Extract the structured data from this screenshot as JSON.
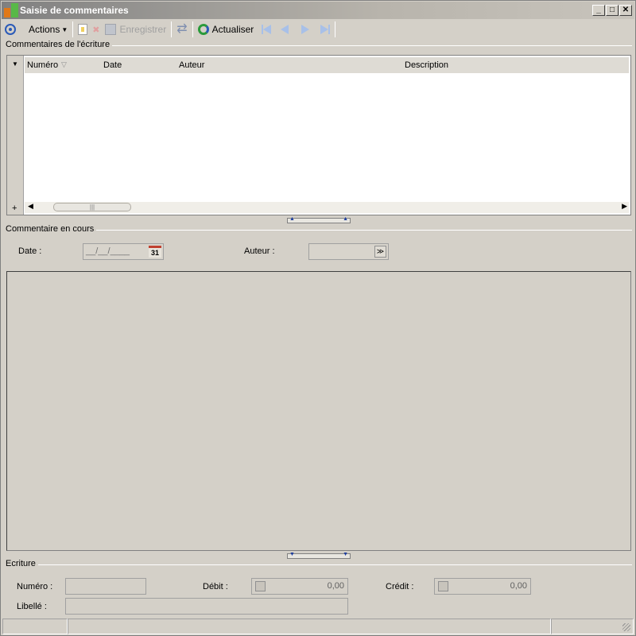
{
  "window": {
    "title": "Saisie de commentaires"
  },
  "toolbar": {
    "actions_label": "Actions",
    "save_label": "Enregistrer",
    "refresh_label": "Actualiser"
  },
  "grid_group": {
    "title": "Commentaires de l'écriture",
    "columns": [
      "Numéro",
      "Date",
      "Auteur",
      "Description"
    ],
    "add_label": "+"
  },
  "current": {
    "title": "Commentaire en cours",
    "date_label": "Date :",
    "date_value": "__/__/____",
    "calendar_day": "31",
    "author_label": "Auteur :"
  },
  "entry": {
    "title": "Ecriture",
    "number_label": "Numéro :",
    "debit_label": "Débit :",
    "debit_value": "0,00",
    "credit_label": "Crédit :",
    "credit_value": "0,00",
    "label_label": "Libellé :"
  }
}
